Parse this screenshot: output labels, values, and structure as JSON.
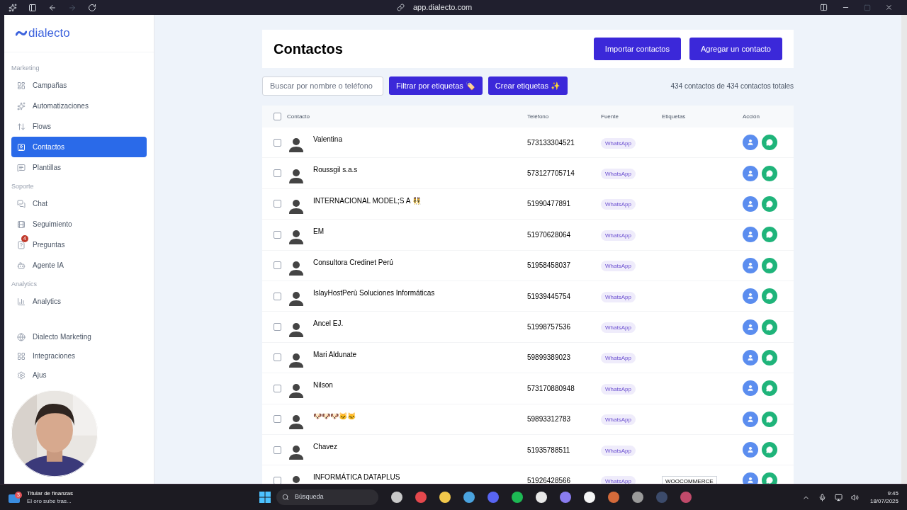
{
  "browser": {
    "url": "app.dialecto.com"
  },
  "sidebar": {
    "logo": "dialecto",
    "sections": [
      {
        "heading": "Marketing",
        "items": [
          {
            "label": "Campañas",
            "selected": false
          },
          {
            "label": "Automatizaciones",
            "selected": false
          },
          {
            "label": "Flows",
            "selected": false
          },
          {
            "label": "Contactos",
            "selected": true
          },
          {
            "label": "Plantillas",
            "selected": false
          }
        ]
      },
      {
        "heading": "Soporte",
        "items": [
          {
            "label": "Chat",
            "selected": false
          },
          {
            "label": "Seguimiento",
            "selected": false
          },
          {
            "label": "Preguntas",
            "selected": false,
            "badge": "4"
          },
          {
            "label": "Agente IA",
            "selected": false
          }
        ]
      },
      {
        "heading": "Analytics",
        "items": [
          {
            "label": "Analytics",
            "selected": false
          }
        ]
      }
    ],
    "bottom_items": [
      {
        "label": "Dialecto Marketing"
      },
      {
        "label": "Integraciones"
      },
      {
        "label": "Ajus"
      }
    ]
  },
  "page": {
    "title": "Contactos",
    "buttons": [
      "Importar contactos",
      "Agregar un contacto"
    ],
    "search": {
      "placeholder": "Buscar por nombre o teléfono"
    },
    "tools": [
      "Filtrar por etiquetas 🏷️",
      "Crear etiquetas ✨"
    ],
    "count": "434 contactos de 434 contactos totales"
  },
  "table": {
    "header_checked": false,
    "columns": [
      "Contacto",
      "Teléfono",
      "Fuente",
      "Etiquetas",
      "Acción"
    ],
    "rows": [
      {
        "name": "Valentina",
        "phone": "573133304521",
        "source": "WhatsApp",
        "checked": false
      },
      {
        "name": "Roussgil s.a.s",
        "phone": "573127705714",
        "source": "WhatsApp",
        "checked": false
      },
      {
        "name": "INTERNACIONAL MODEL;S A 👯",
        "phone": "51990477891",
        "source": "WhatsApp",
        "checked": false
      },
      {
        "name": "EM",
        "phone": "51970628064",
        "source": "WhatsApp",
        "checked": false
      },
      {
        "name": "Consultora Credinet Perú",
        "phone": "51958458037",
        "source": "WhatsApp",
        "checked": false
      },
      {
        "name": "IslayHostPerù Soluciones Informáticas",
        "phone": "51939445754",
        "source": "WhatsApp",
        "checked": false
      },
      {
        "name": "Ancel EJ.",
        "phone": "51998757536",
        "source": "WhatsApp",
        "checked": false
      },
      {
        "name": "Mari Aldunate",
        "phone": "59899389023",
        "source": "WhatsApp",
        "checked": false
      },
      {
        "name": "Nilson",
        "phone": "573170880948",
        "source": "WhatsApp",
        "checked": false
      },
      {
        "name": "🐶🐶🐶🐱🐱",
        "phone": "59893312783",
        "source": "WhatsApp",
        "checked": false
      },
      {
        "name": "Chavez",
        "phone": "51935788511",
        "source": "WhatsApp",
        "checked": false
      },
      {
        "name": "INFORMÁTICA DATAPLUS",
        "phone": "51926428566",
        "source": "WhatsApp",
        "tags": [
          "WOOCOMMERCE"
        ],
        "checked": false
      }
    ]
  },
  "taskbar": {
    "widget": {
      "badge": "3",
      "title": "Titular de finanzas",
      "subtitle": "El oro sube tras..."
    },
    "search": {
      "placeholder": "Búsqueda"
    },
    "time": "9:45",
    "date": "18/07/2025"
  }
}
